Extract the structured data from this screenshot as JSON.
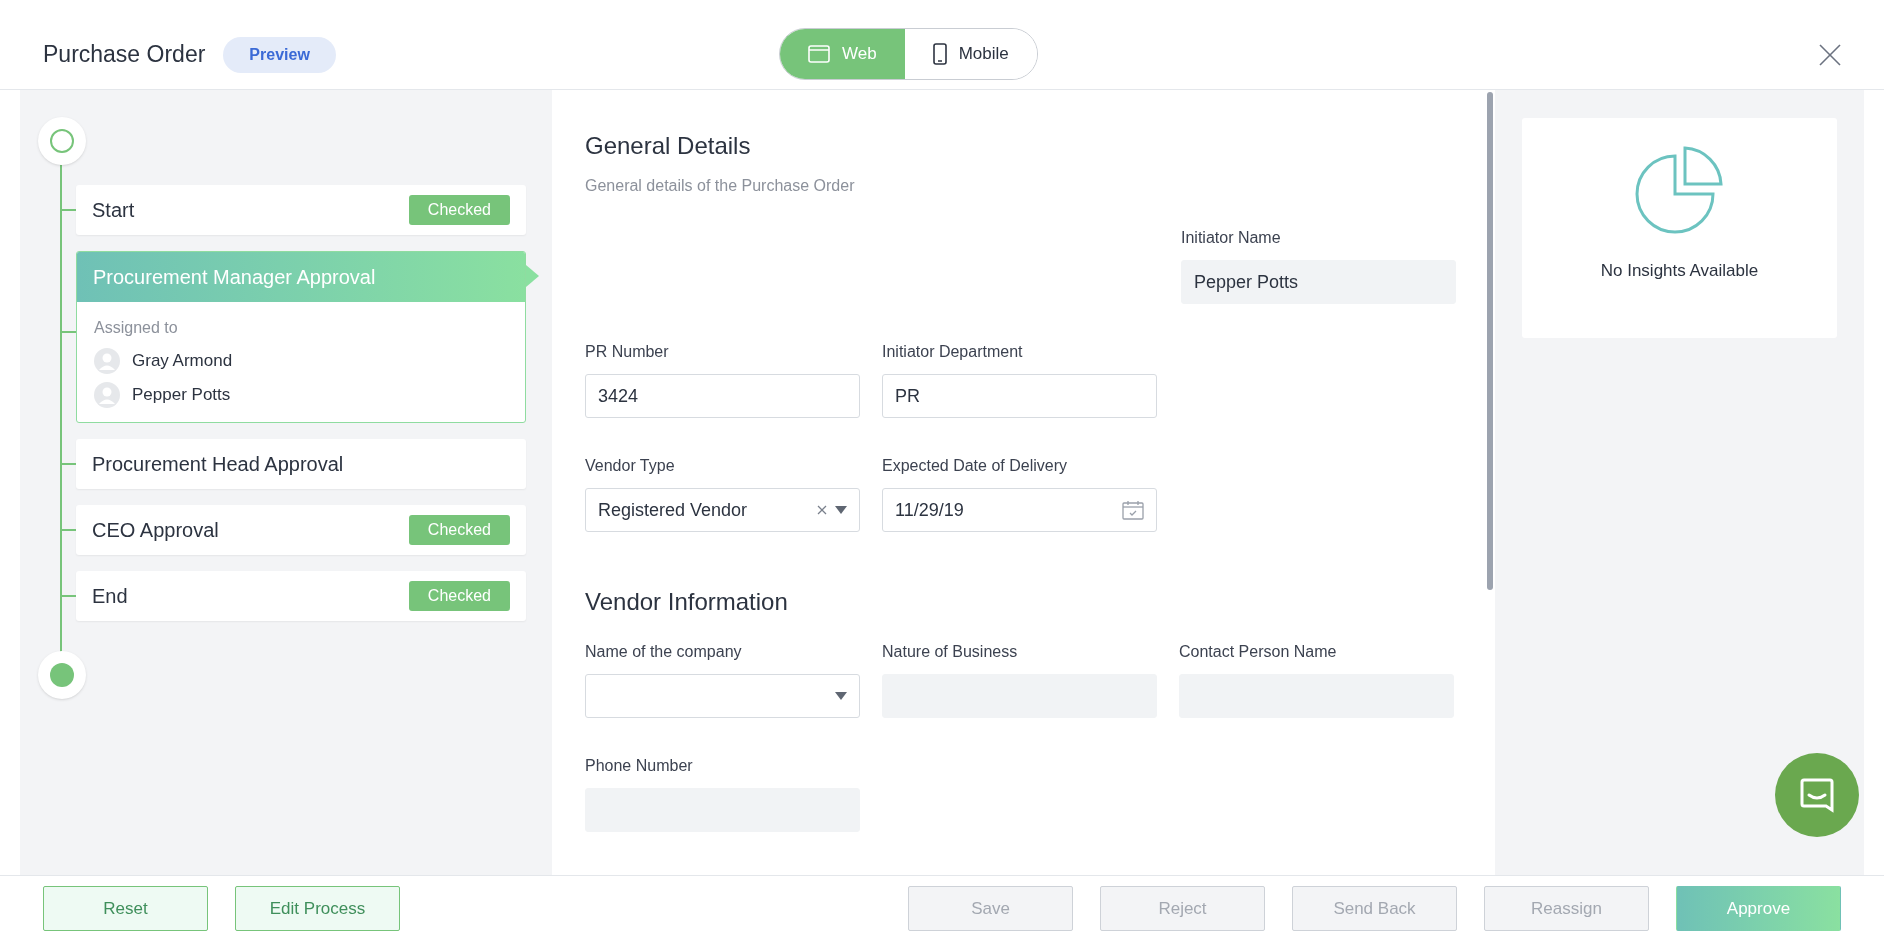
{
  "header": {
    "title": "Purchase Order",
    "badge": "Preview",
    "views": [
      {
        "label": "Web",
        "selected": true
      },
      {
        "label": "Mobile",
        "selected": false
      }
    ]
  },
  "workflow": {
    "steps": [
      {
        "name": "Start",
        "badge": "Checked",
        "checked": true,
        "selected": false
      },
      {
        "name": "Procurement Manager Approval",
        "checked": false,
        "selected": true,
        "assigned_label": "Assigned to",
        "assignees": [
          "Gray Armond",
          "Pepper Potts"
        ]
      },
      {
        "name": "Procurement Head Approval",
        "checked": false,
        "selected": false
      },
      {
        "name": "CEO Approval",
        "badge": "Checked",
        "checked": true,
        "selected": false
      },
      {
        "name": "End",
        "badge": "Checked",
        "checked": true,
        "selected": false
      }
    ]
  },
  "form": {
    "sections": [
      {
        "title": "General Details",
        "subtitle": "General details of the Purchase Order",
        "rows": [
          {
            "fields": [
              {
                "label": "Initiator Name",
                "kind": "text",
                "readonly": true,
                "value": "Pepper Potts"
              }
            ]
          },
          {
            "fields": [
              {
                "label": "PR Number",
                "kind": "text",
                "readonly": false,
                "value": "3424"
              },
              {
                "label": "Initiator Department",
                "kind": "text",
                "readonly": false,
                "value": "PR"
              }
            ]
          },
          {
            "fields": [
              {
                "label": "Vendor Type",
                "kind": "select",
                "readonly": false,
                "value": "Registered Vendor",
                "clearable": true
              },
              {
                "label": "Expected Date of Delivery",
                "kind": "date",
                "readonly": false,
                "value": "11/29/19"
              }
            ]
          }
        ]
      },
      {
        "title": "Vendor Information",
        "rows": [
          {
            "fields": [
              {
                "label": "Name of the company",
                "kind": "select",
                "readonly": false,
                "clearable": false
              },
              {
                "label": "Nature of Business",
                "kind": "text",
                "readonly": true
              },
              {
                "label": "Contact Person Name",
                "kind": "text",
                "readonly": true
              }
            ]
          },
          {
            "fields": [
              {
                "label": "Phone Number",
                "kind": "text",
                "readonly": true
              }
            ]
          }
        ]
      }
    ]
  },
  "insights": {
    "message": "No Insights Available"
  },
  "actions": [
    {
      "label": "Reset",
      "kind": "secondary",
      "disabled": false
    },
    {
      "label": "Edit Process",
      "kind": "secondary",
      "disabled": false
    },
    {
      "label": "Save",
      "kind": "default",
      "disabled": true
    },
    {
      "label": "Reject",
      "kind": "default",
      "disabled": true
    },
    {
      "label": "Send Back",
      "kind": "default",
      "disabled": true
    },
    {
      "label": "Reassign",
      "kind": "default",
      "disabled": true
    },
    {
      "label": "Approve",
      "kind": "primary",
      "disabled": false
    }
  ]
}
